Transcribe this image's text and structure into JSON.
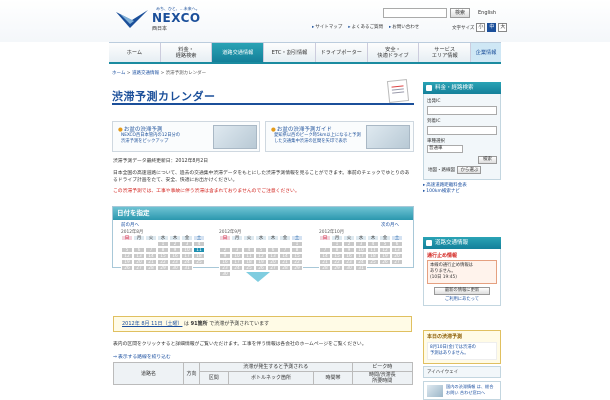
{
  "header": {
    "tagline": "みち、ひと、…未来へ。",
    "brand": "NEXCO",
    "brand_sub": "西日本",
    "search_button": "検索",
    "language": "English",
    "util_links": [
      "サイトマップ",
      "よくあるご質問",
      "お問い合わせ"
    ],
    "font_size_label": "文字サイズ",
    "font_sizes": [
      "小",
      "中",
      "大"
    ]
  },
  "nav": [
    {
      "label": "ホーム"
    },
    {
      "label": "料金・\n経路検索"
    },
    {
      "label": "道路交通情報"
    },
    {
      "label": "ETC・割引情報"
    },
    {
      "label": "ドライブポーター"
    },
    {
      "label": "安全・\n快適ドライブ"
    },
    {
      "label": "サービス\nエリア情報"
    },
    {
      "label": "企業情報"
    }
  ],
  "breadcrumb": [
    "ホーム",
    "道路交通情報",
    "渋滞予測カレンダー"
  ],
  "page_title": "渋滞予測カレンダー",
  "guides": [
    {
      "title": "お盆の渋滞予測",
      "desc": "NEXCO西日本管内の12日分の\n渋滞予測をピックアップ"
    },
    {
      "title": "お盆の渋滞予測ガイド",
      "desc": "愛知県以西のピーク時5km以上になると予測\nした交通集中渋滞の区間を矢印で表示"
    }
  ],
  "update_text": "渋滞予測データ最終更新日：2012年8月2日",
  "intro_text": "日本全国の高速道路について、過去の交通集中渋滞データをもとにした渋滞予測情報を見ることができます。事前のチェックでゆとりのあるドライブ計画をたて、安全、快適にお出かけください。",
  "warning_text": "この渋滞予測では、工事や事故に伴う渋滞は含まれておりませんのでご注意ください。",
  "calendar": {
    "header": "日付を指定",
    "prev": "前の月へ",
    "next": "次の月へ",
    "weekdays": [
      "日",
      "月",
      "火",
      "水",
      "木",
      "金",
      "土"
    ],
    "months": [
      {
        "label": "2012年8月",
        "first_dow": 3,
        "days": 31,
        "selected": 11
      },
      {
        "label": "2012年9月",
        "first_dow": 6,
        "days": 30,
        "selected": 0
      },
      {
        "label": "2012年10月",
        "first_dow": 1,
        "days": 31,
        "selected": 0
      }
    ]
  },
  "result": {
    "date_text": "2012年 8月 11日（土曜）",
    "mid": "は",
    "count": "91箇所",
    "tail": "で渋滞が予測されています"
  },
  "desc_text": "表内の区間をクリックすると詳細情報がご覧いただけます。工事を伴う情報は各会社のホームページをご覧ください。",
  "route_link": "表示する路線を絞り込む",
  "table": {
    "row1": [
      "道路名",
      "方向",
      "渋滞が発生すると予測される",
      "ピーク時"
    ],
    "row2": [
      "区間",
      "ボトルネック箇所",
      "時間帯",
      "時間/渋滞長\n所要時間"
    ]
  },
  "sidebar": {
    "search_title": "料金・経路検索",
    "from_label": "出発IC",
    "to_label": "到着IC",
    "car_label": "車種選択",
    "car_value": "普通車",
    "search_button": "検索",
    "map_label": "地図・路線図",
    "map_button": "から選ぶ",
    "links": [
      "高速道路距離料金表",
      "100km検索ナビ"
    ],
    "traffic_title": "道路交通情報",
    "alert_title": "通行止め情報",
    "alert_body": "本線の通行止め情報は\nありません。\n(10日 19:45)",
    "update_button": "最新の情報に更新",
    "usage": "ご利用にあたって",
    "today_title": "本日の渋滞予測",
    "today_body": "8月10日(金)では渋滞の\n予測はありません。",
    "ihighway": "アイハイウェイ",
    "banner": "国内の渋滞情報\nは、総合お問い\n合わせ窓口へ"
  },
  "colors": {
    "brand": "#1b4f9a",
    "teal": "#2aa3b5",
    "warning": "#d2231e",
    "selected_day": "#1e8fb0"
  }
}
